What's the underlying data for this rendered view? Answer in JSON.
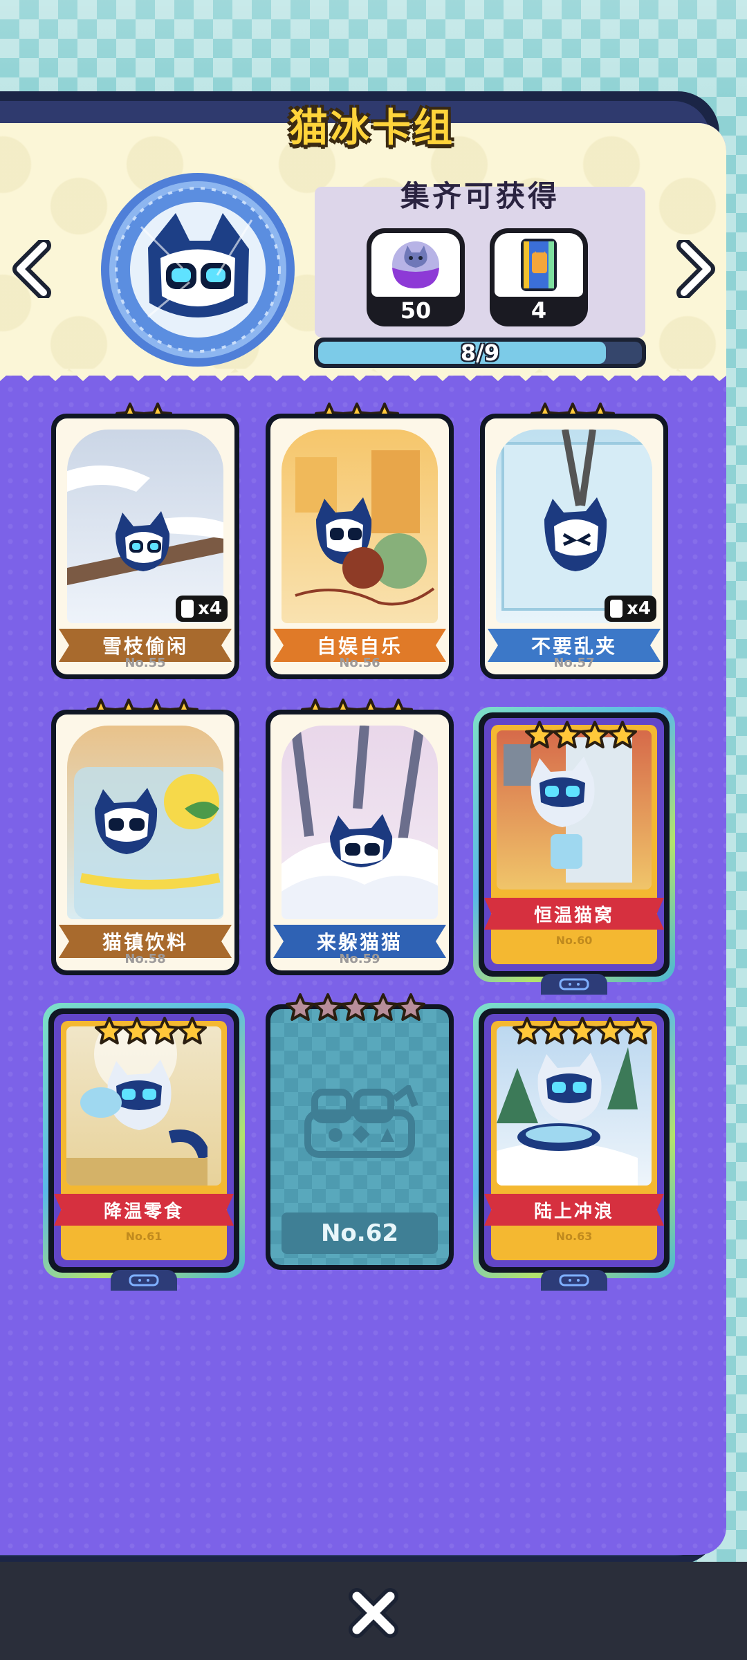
{
  "header": {
    "title": "猫冰卡组"
  },
  "rewards": {
    "title": "集齐可获得",
    "items": [
      {
        "icon": "cat-capsule-icon",
        "count": "50"
      },
      {
        "icon": "card-pack-icon",
        "count": "4"
      }
    ],
    "progress": {
      "label": "8/9",
      "value": 8,
      "max": 9
    }
  },
  "cards": [
    {
      "name": "雪枝偷闲",
      "no": "No.55",
      "stars": 2,
      "duplicates": "x4",
      "ribbon_color": "#a86a2d"
    },
    {
      "name": "自娱自乐",
      "no": "No.56",
      "stars": 3,
      "duplicates": "",
      "ribbon_color": "#e07a28"
    },
    {
      "name": "不要乱夹",
      "no": "No.57",
      "stars": 3,
      "duplicates": "x4",
      "ribbon_color": "#3c78c8"
    },
    {
      "name": "猫镇饮料",
      "no": "No.58",
      "stars": 4,
      "duplicates": "",
      "ribbon_color": "#a86a2d"
    },
    {
      "name": "来躲猫猫",
      "no": "No.59",
      "stars": 4,
      "duplicates": "",
      "ribbon_color": "#2f62b4"
    },
    {
      "name": "恒温猫窝",
      "no": "No.60",
      "stars": 4,
      "duplicates": "",
      "rare": true
    },
    {
      "name": "降温零食",
      "no": "No.61",
      "stars": 4,
      "duplicates": "",
      "rare": true
    },
    {
      "name": "",
      "no": "No.62",
      "stars": 5,
      "locked": true
    },
    {
      "name": "陆上冲浪",
      "no": "No.63",
      "stars": 5,
      "duplicates": "",
      "rare": true
    }
  ],
  "colors": {
    "panel": "#7c62e8",
    "header_bg": "#fbf6d7",
    "star": "#ffc83a",
    "locked": "#4e9bb0"
  }
}
